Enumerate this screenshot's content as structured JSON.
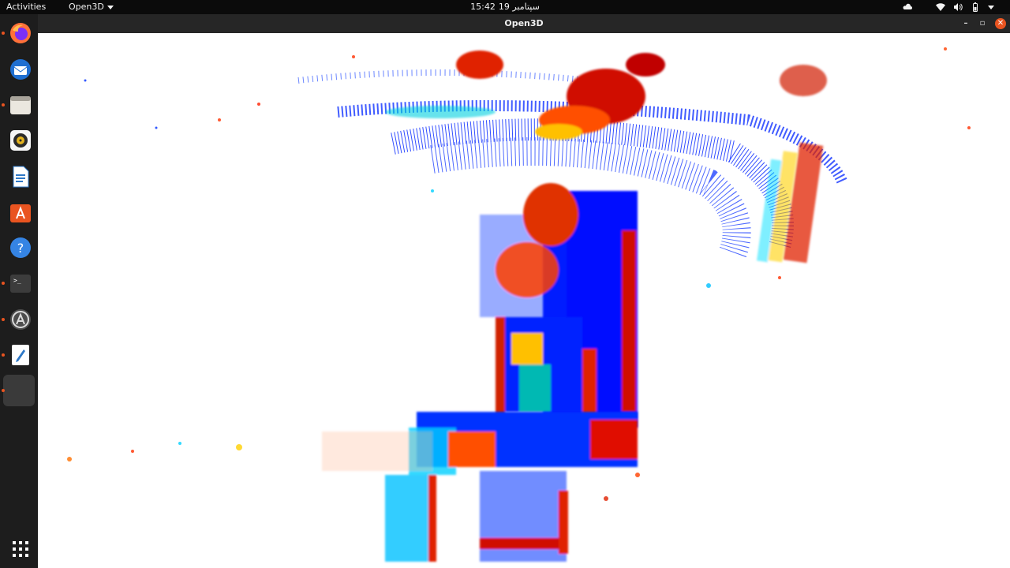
{
  "topbar": {
    "activities_label": "Activities",
    "app_menu_label": "Open3D",
    "clock": {
      "date": "سپتامبر 19",
      "time": "15:42"
    }
  },
  "dock": {
    "items": [
      {
        "name": "firefox",
        "icon": "firefox-icon",
        "running": true
      },
      {
        "name": "thunderbird",
        "icon": "mail-icon",
        "running": false
      },
      {
        "name": "files",
        "icon": "folder-icon",
        "running": true
      },
      {
        "name": "rhythmbox",
        "icon": "speaker-icon",
        "running": false
      },
      {
        "name": "libreoffice-writer",
        "icon": "document-icon",
        "running": false
      },
      {
        "name": "ubuntu-software",
        "icon": "software-store-icon",
        "running": false
      },
      {
        "name": "help",
        "icon": "help-icon",
        "running": false
      },
      {
        "name": "terminal",
        "icon": "terminal-icon",
        "running": true
      },
      {
        "name": "software-updater",
        "icon": "updater-icon",
        "running": true
      },
      {
        "name": "text-editor",
        "icon": "text-editor-icon",
        "running": true
      },
      {
        "name": "open3d",
        "icon": "blank-app-icon",
        "running": true
      }
    ],
    "show_apps_icon": "app-grid-icon"
  },
  "window": {
    "title": "Open3D",
    "controls": {
      "minimize": "–",
      "maximize": "▫",
      "close": "✕"
    }
  },
  "viewer": {
    "content": "point-cloud-3d-scan",
    "colormap": [
      "#0000ff",
      "#00e0ff",
      "#00ff80",
      "#ffff00",
      "#ff8000",
      "#e00000"
    ],
    "background": "#ffffff"
  }
}
